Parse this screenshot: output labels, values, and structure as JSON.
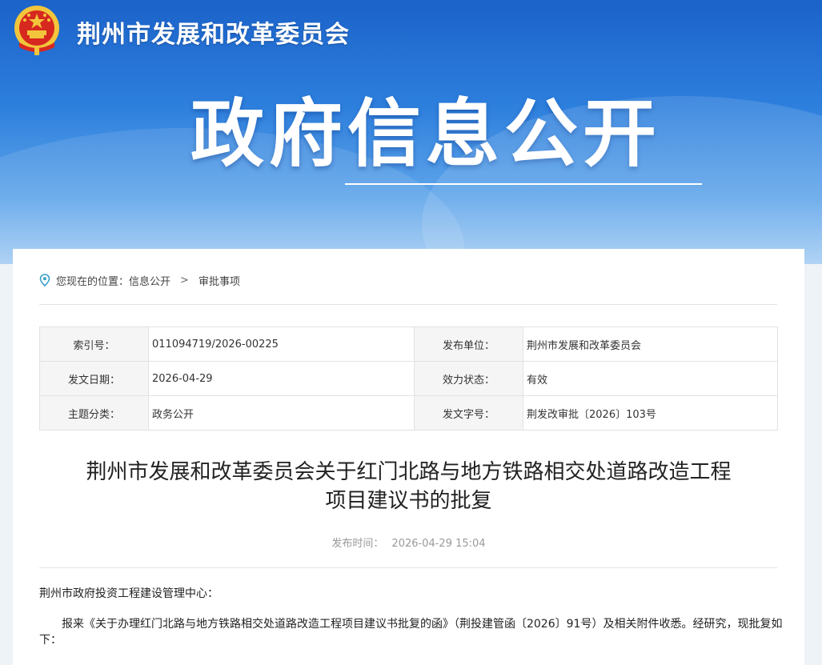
{
  "header": {
    "site_name": "荆州市发展和改革委员会",
    "banner_title": "政府信息公开"
  },
  "breadcrumb": {
    "prefix": "您现在的位置：",
    "items": [
      "信息公开",
      "审批事项"
    ],
    "separator": ">"
  },
  "meta": {
    "rows": [
      {
        "k1": "索引号：",
        "v1": "011094719/2026-00225",
        "k2": "发布单位：",
        "v2": "荆州市发展和改革委员会"
      },
      {
        "k1": "发文日期：",
        "v1": "2026-04-29",
        "k2": "效力状态：",
        "v2": "有效"
      },
      {
        "k1": "主题分类：",
        "v1": "政务公开",
        "k2": "发文字号：",
        "v2": "荆发改审批〔2026〕103号"
      }
    ]
  },
  "article": {
    "title_line1": "荆州市发展和改革委员会关于红门北路与地方铁路相交处道路改造工程",
    "title_line2": "项目建议书的批复",
    "pub_label": "发布时间：",
    "pub_time": "2026-04-29 15:04",
    "recipient": "荆州市政府投资工程建设管理中心：",
    "para1": "报来《关于办理红门北路与地方铁路相交处道路改造工程项目建议书批复的函》（荆投建管函〔2026〕91号）及相关附件收悉。经研究，现批复如下："
  },
  "colors": {
    "banner_top": "#1b62c9",
    "banner_bottom": "#a6cdf3",
    "emblem_red": "#d7281f",
    "emblem_gold": "#f3c53c"
  }
}
